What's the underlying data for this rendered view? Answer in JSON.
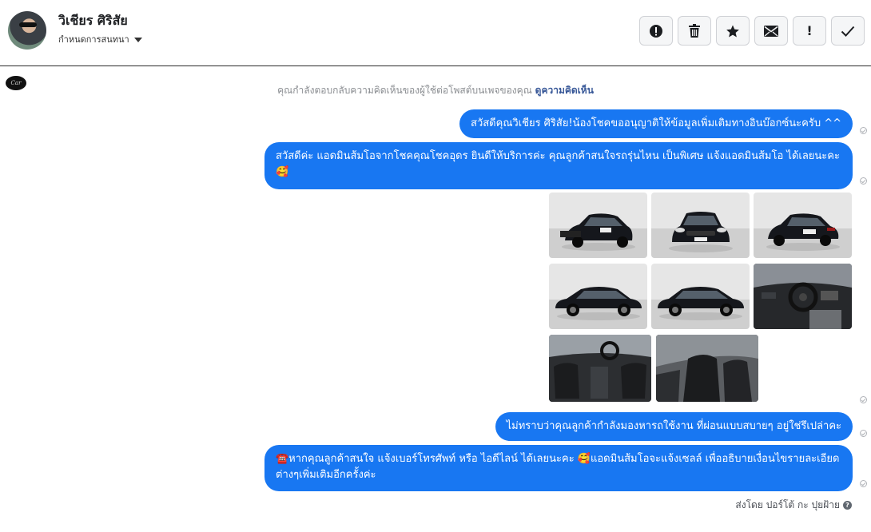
{
  "header": {
    "contact_name": "วิเชียร ศิริสัย",
    "assign_label": "กำหนดการสนทนา",
    "tools": [
      {
        "icon": "alert-icon",
        "glyph": ""
      },
      {
        "icon": "trash-icon",
        "glyph": ""
      },
      {
        "icon": "star-icon",
        "glyph": ""
      },
      {
        "icon": "mail-icon",
        "glyph": ""
      },
      {
        "icon": "exclamation-icon",
        "glyph": "!"
      },
      {
        "icon": "check-icon",
        "glyph": ""
      }
    ]
  },
  "page_logo": {
    "text": "Car"
  },
  "notice": {
    "text": "คุณกำลังตอบกลับความคิดเห็นของผู้ใช้ต่อโพสต์บนเพจของคุณ",
    "link": "ดูความคิดเห็น"
  },
  "messages": [
    {
      "text": "สวัสดีคุณวิเชียร ศิริสัย!น้องโชคขออนุญาติให้ข้อมูลเพิ่มเติมทางอินบ๊อกซ์นะครับ ^^"
    },
    {
      "text": "สวัสดีค่ะ แอดมินส้มโอจากโชคคุณโชคอุดร ยินดีให้บริการค่ะ   คุณลูกค้าสนใจรถรุ่นไหน เป็นพิเศษ แจ้งแอดมินส้มโอ ได้เลยนะคะ🥰"
    },
    {
      "text": "ไม่ทราบว่าคุณลูกค้ากำลังมองหารถใช้งาน ที่ผ่อนแบบสบายๆ อยู่ใช่รึเปล่าคะ"
    },
    {
      "text": "☎️หากคุณลูกค้าสนใจ แจ้งเบอร์โทรศัพท์ หรือ ไอดีไลน์  ได้เลยนะคะ 🥰แอดมินส้มโอจะแจ้งเซลล์   เพื่ออธิบายเงื่อนไขรายละเอียดต่างๆเพิ่มเติมอีกครั้งค่ะ"
    }
  ],
  "photos": [
    {
      "kind": "front-left"
    },
    {
      "kind": "front"
    },
    {
      "kind": "rear-left"
    },
    {
      "kind": "side-left"
    },
    {
      "kind": "side-right"
    },
    {
      "kind": "dashboard"
    },
    {
      "kind": "interior-front"
    },
    {
      "kind": "interior-seat"
    }
  ],
  "footer": {
    "sent_by": "ส่งโดย ปอร์โต้ กะ ปุยฝ้าย",
    "help_glyph": "?"
  },
  "colors": {
    "bubble": "#1877f2",
    "car": "#15171c"
  }
}
